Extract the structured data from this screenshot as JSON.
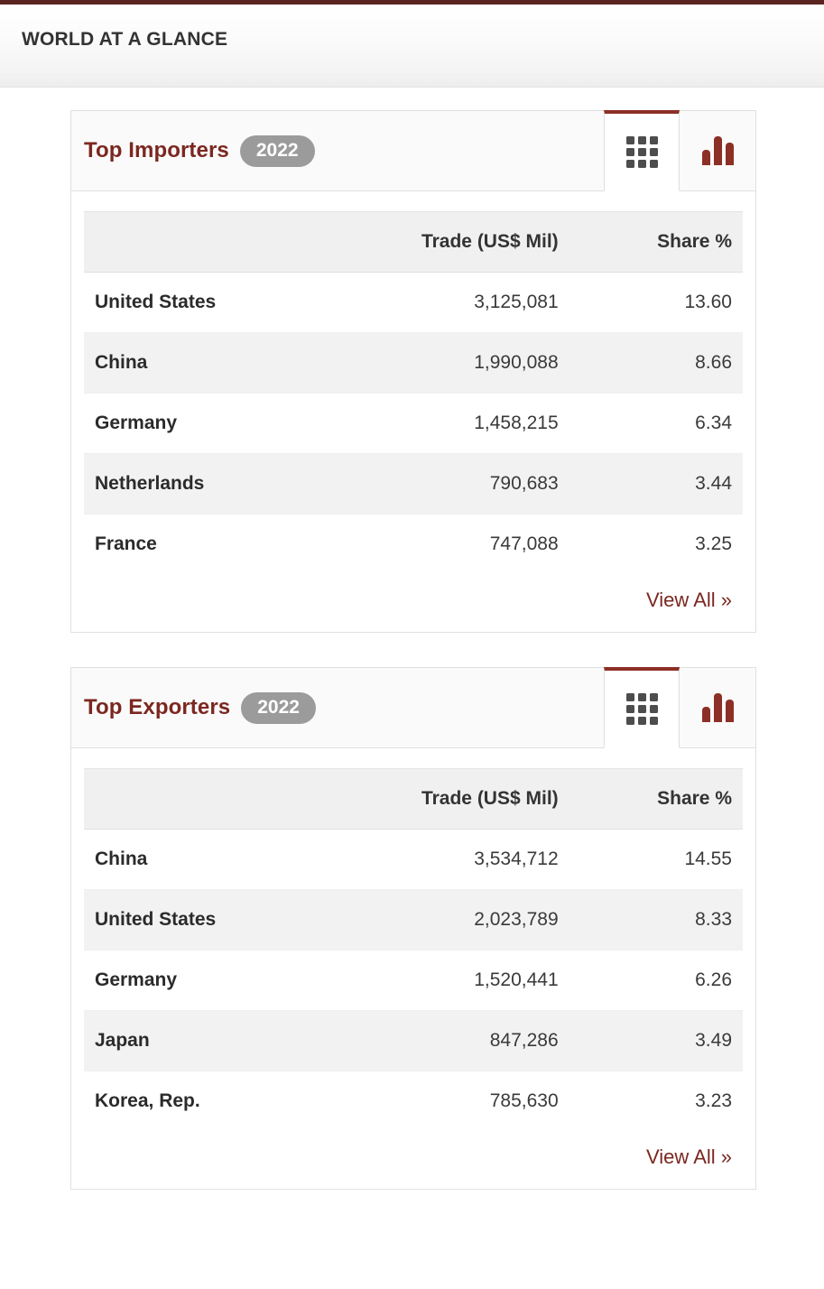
{
  "header": {
    "title": "WORLD AT A GLANCE",
    "accent_color": "#5c2420"
  },
  "theme": {
    "brand_red": "#7b2720",
    "tab_active_red": "#8c2f26",
    "badge_gray": "#9b9b9b",
    "row_stripe": "#f2f2f2",
    "table_header_bg": "#f0f0f0"
  },
  "columns": {
    "name": "",
    "trade": "Trade (US$ Mil)",
    "share": "Share %"
  },
  "cards": [
    {
      "title": "Top Importers",
      "year": "2022",
      "tabs": [
        {
          "name": "grid-view",
          "icon": "grid-icon",
          "active": true
        },
        {
          "name": "chart-view",
          "icon": "bar-chart-icon",
          "active": false
        }
      ],
      "rows": [
        {
          "name": "United States",
          "trade": "3,125,081",
          "share": "13.60"
        },
        {
          "name": "China",
          "trade": "1,990,088",
          "share": "8.66"
        },
        {
          "name": "Germany",
          "trade": "1,458,215",
          "share": "6.34"
        },
        {
          "name": "Netherlands",
          "trade": "790,683",
          "share": "3.44"
        },
        {
          "name": "France",
          "trade": "747,088",
          "share": "3.25"
        }
      ],
      "view_all": "View All »"
    },
    {
      "title": "Top Exporters",
      "year": "2022",
      "tabs": [
        {
          "name": "grid-view",
          "icon": "grid-icon",
          "active": true
        },
        {
          "name": "chart-view",
          "icon": "bar-chart-icon",
          "active": false
        }
      ],
      "rows": [
        {
          "name": "China",
          "trade": "3,534,712",
          "share": "14.55"
        },
        {
          "name": "United States",
          "trade": "2,023,789",
          "share": "8.33"
        },
        {
          "name": "Germany",
          "trade": "1,520,441",
          "share": "6.26"
        },
        {
          "name": "Japan",
          "trade": "847,286",
          "share": "3.49"
        },
        {
          "name": "Korea, Rep.",
          "trade": "785,630",
          "share": "3.23"
        }
      ],
      "view_all": "View All »"
    }
  ],
  "chart_data": [
    {
      "type": "table",
      "title": "Top Importers 2022",
      "categories": [
        "United States",
        "China",
        "Germany",
        "Netherlands",
        "France"
      ],
      "series": [
        {
          "name": "Trade (US$ Mil)",
          "values": [
            3125081,
            1990088,
            1458215,
            790683,
            747088
          ]
        },
        {
          "name": "Share %",
          "values": [
            13.6,
            8.66,
            6.34,
            3.44,
            3.25
          ]
        }
      ],
      "xlabel": "",
      "ylabel": "Trade (US$ Mil)"
    },
    {
      "type": "table",
      "title": "Top Exporters 2022",
      "categories": [
        "China",
        "United States",
        "Germany",
        "Japan",
        "Korea, Rep."
      ],
      "series": [
        {
          "name": "Trade (US$ Mil)",
          "values": [
            3534712,
            2023789,
            1520441,
            847286,
            785630
          ]
        },
        {
          "name": "Share %",
          "values": [
            14.55,
            8.33,
            6.26,
            3.49,
            3.23
          ]
        }
      ],
      "xlabel": "",
      "ylabel": "Trade (US$ Mil)"
    }
  ]
}
